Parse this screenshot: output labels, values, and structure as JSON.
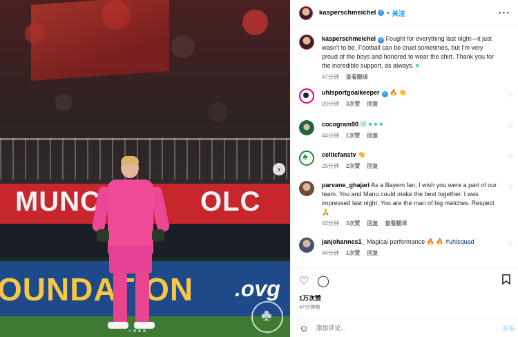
{
  "photo": {
    "banner_left": "MUNC",
    "banner_right": "OLC",
    "led_text": "OUNDATION",
    "led_text_right": ".ovg",
    "next_icon": "chevron-right-icon",
    "dots": 4,
    "active_dot": 1
  },
  "header": {
    "username": "kasperschmeichel",
    "separator": "•",
    "follow_label": "关注",
    "more_icon": "more-horizontal-icon"
  },
  "caption": {
    "username": "kasperschmeichel",
    "text": "Fought for everything last night—it just wasn't to be. Football can be cruel sometimes, but I'm very proud of the boys and honored to wear the shirt. Thank you for the incredible support, as always.",
    "emoji": "♥",
    "time": "47分钟",
    "translation_label": "查看翻译"
  },
  "comments": [
    {
      "username": "uhlsportgoalkeeper",
      "text": "",
      "emoji": "🔥 👏",
      "time": "20分钟",
      "likes": "3次赞",
      "reply": "回复",
      "translation": ""
    },
    {
      "username": "cocogram90",
      "text": "",
      "emoji": "😻 ♥ ♥ ♥",
      "time": "44分钟",
      "likes": "1次赞",
      "reply": "回复",
      "translation": ""
    },
    {
      "username": "celticfanstv",
      "text": "",
      "emoji": "👏",
      "time": "25分钟",
      "likes": "2次赞",
      "reply": "回复",
      "translation": ""
    },
    {
      "username": "parvane_ghajari",
      "text": "As a Bayern fan, I wish you were a part of our team. You and Manu could make the best together. I was impressed last night. You are the man of big matches. Respect",
      "emoji": "🙏",
      "time": "42分钟",
      "likes": "3次赞",
      "reply": "回复",
      "translation": "查看翻译"
    },
    {
      "username": "janjohannes1_",
      "text": "Magical performance",
      "emoji": "🔥 🔥",
      "hashtag": "#uhlsquad",
      "time": "44分钟",
      "likes": "1次赞",
      "reply": "回复",
      "translation": ""
    }
  ],
  "actions": {
    "like_icon": "heart-icon",
    "comment_icon": "comment-icon",
    "save_icon": "bookmark-icon",
    "likes_count": "1万次赞",
    "posted_ago": "47分钟前"
  },
  "add_comment": {
    "placeholder": "添加评论...",
    "post_label": "发布",
    "emoji_icon": "smile-icon"
  },
  "colors": {
    "accent": "#0095f6",
    "verified": "#3897f0",
    "jersey": "#ee4a98"
  }
}
